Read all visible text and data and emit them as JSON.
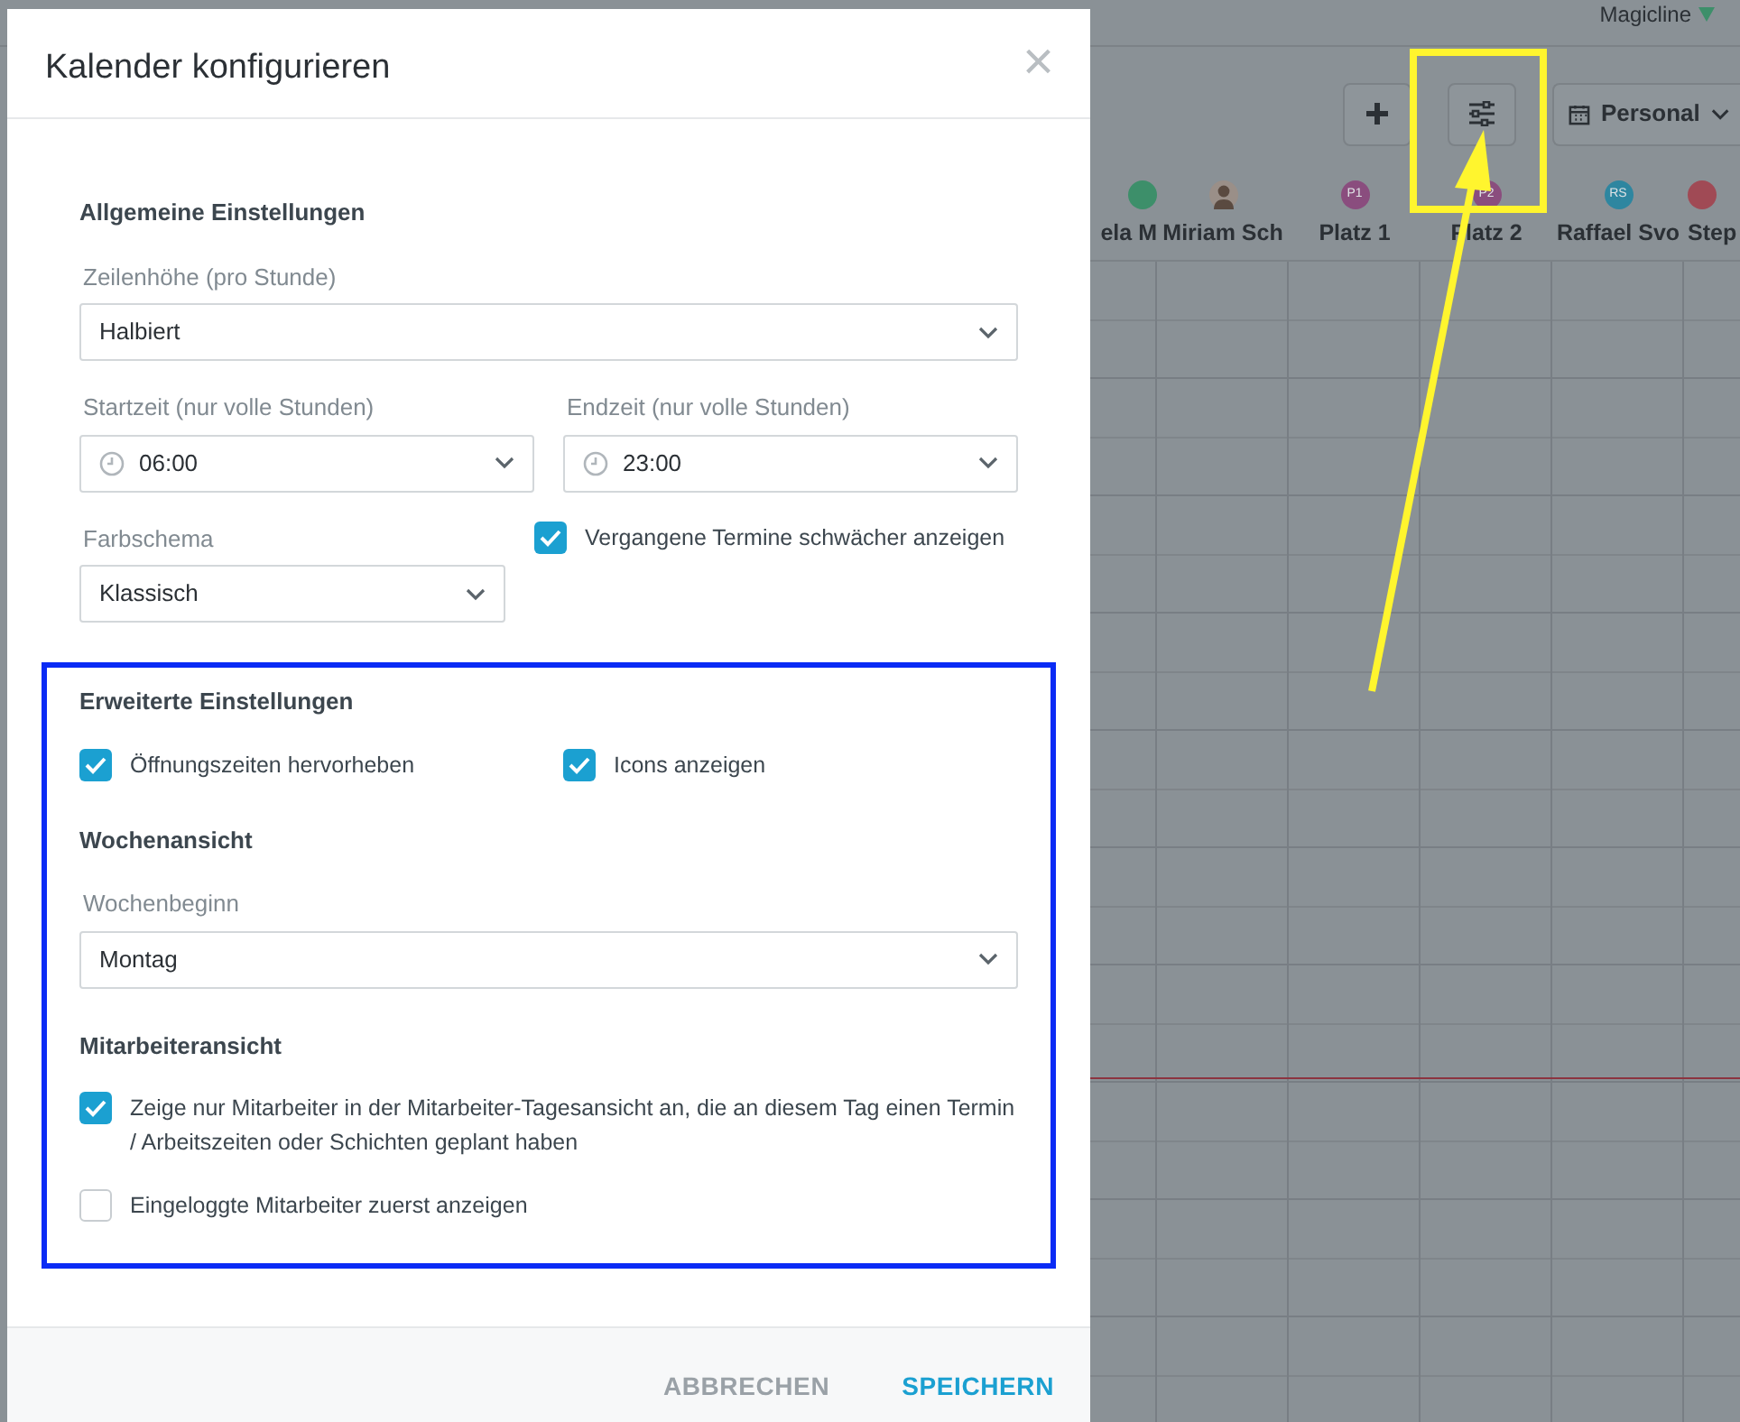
{
  "background": {
    "brand": "Magicline",
    "view_dropdown": "Personal",
    "columns": [
      {
        "name": "ela M",
        "kind": "initials",
        "color": "#3d8f6a"
      },
      {
        "name": "Miriam Sch",
        "kind": "photo",
        "color": "#9a8f88"
      },
      {
        "name": "Platz 1",
        "kind": "initials",
        "initials": "P1",
        "color": "#8a4d7e"
      },
      {
        "name": "Platz 2",
        "kind": "initials",
        "initials": "P2",
        "color": "#8a4d7e"
      },
      {
        "name": "Raffael Svo",
        "kind": "initials",
        "initials": "RS",
        "color": "#2e86a0"
      },
      {
        "name": "Step",
        "kind": "initials",
        "color": "#a04a55"
      }
    ]
  },
  "dialog": {
    "title": "Kalender konfigurieren",
    "close": "×",
    "general": {
      "heading": "Allgemeine Einstellungen",
      "rows": [
        [
          {
            "kind": "select",
            "label": "Zeilenhöhe (pro Stunde)",
            "value": "Halbiert"
          }
        ],
        [
          {
            "kind": "time",
            "label": "Startzeit (nur volle Stunden)",
            "value": "06:00"
          },
          {
            "kind": "time",
            "label": "Endzeit (nur volle Stunden)",
            "value": "23:00"
          }
        ],
        [
          {
            "kind": "select",
            "label": "Farbschema",
            "value": "Klassisch"
          },
          {
            "kind": "checkbox",
            "label": "Vergangene Termine schwächer anzeigen",
            "checked": true
          }
        ]
      ]
    },
    "highlighted": [
      {
        "heading": "Erweiterte Einstellungen",
        "rows": [
          [
            {
              "kind": "checkbox",
              "label": "Öffnungszeiten hervorheben",
              "checked": true
            },
            {
              "kind": "checkbox",
              "label": "Icons anzeigen",
              "checked": true
            }
          ]
        ]
      },
      {
        "heading": "Wochenansicht",
        "rows": [
          [
            {
              "kind": "select",
              "label": "Wochenbeginn",
              "value": "Montag"
            }
          ]
        ]
      },
      {
        "heading": "Mitarbeiteransicht",
        "rows": [
          [
            {
              "kind": "checkbox",
              "label": "Zeige nur Mitarbeiter in der Mitarbeiter-Tagesansicht an, die an diesem Tag einen Termin / Arbeitszeiten oder Schichten geplant haben",
              "checked": true
            }
          ],
          [
            {
              "kind": "checkbox",
              "label": "Eingeloggte Mitarbeiter zuerst anzeigen",
              "checked": false
            }
          ]
        ]
      }
    ],
    "buttons": [
      {
        "label": "ABBRECHEN",
        "kind": "secondary"
      },
      {
        "label": "SPEICHERN",
        "kind": "primary"
      }
    ]
  }
}
